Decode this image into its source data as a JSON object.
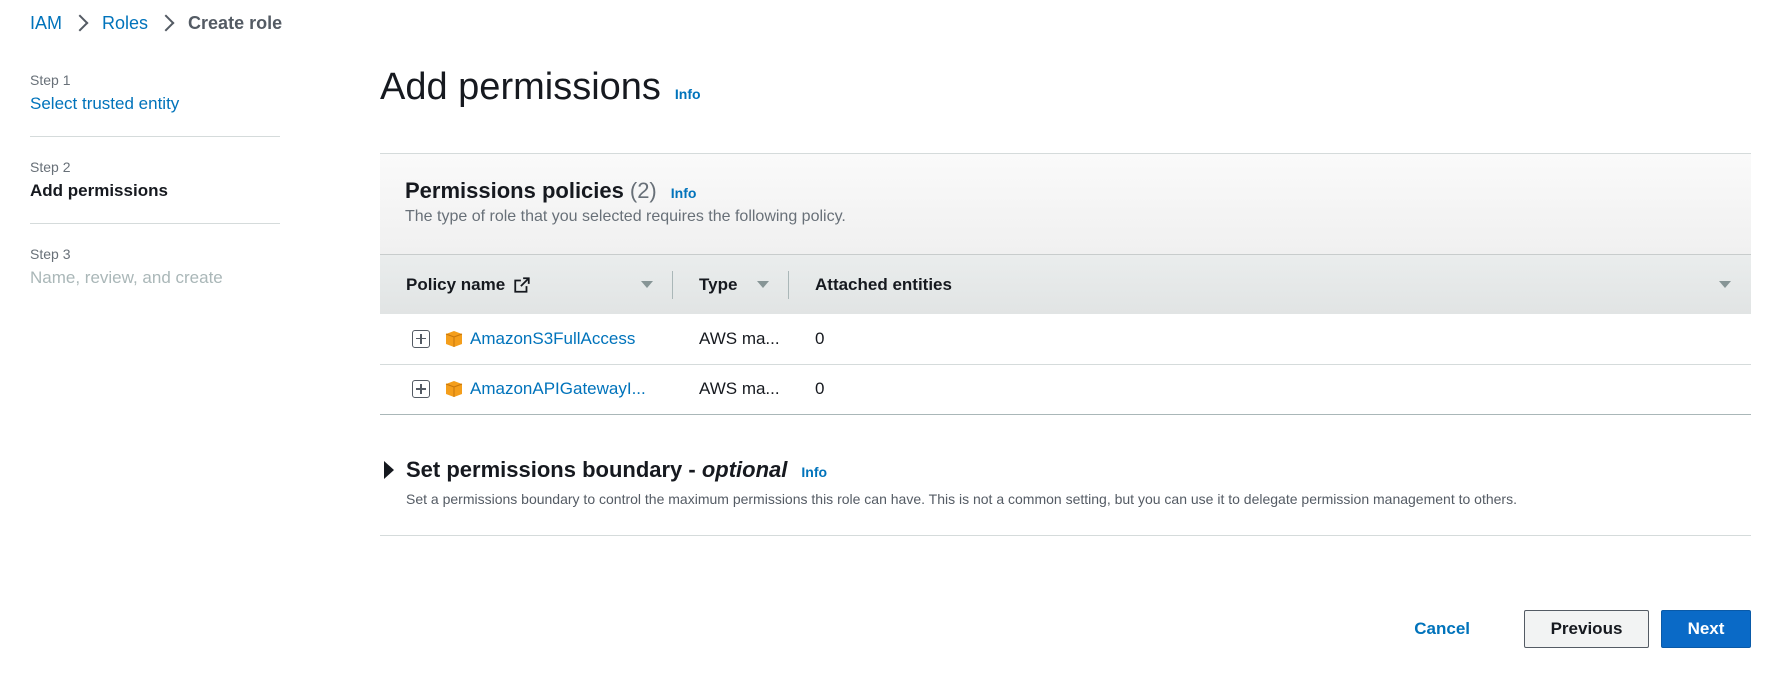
{
  "breadcrumb": {
    "items": [
      "IAM",
      "Roles"
    ],
    "current": "Create role"
  },
  "steps": [
    {
      "num": "Step 1",
      "title": "Select trusted entity",
      "state": "link"
    },
    {
      "num": "Step 2",
      "title": "Add permissions",
      "state": "active"
    },
    {
      "num": "Step 3",
      "title": "Name, review, and create",
      "state": "disabled"
    }
  ],
  "page": {
    "title": "Add permissions",
    "info": "Info"
  },
  "policies_panel": {
    "title": "Permissions policies",
    "count": "(2)",
    "info": "Info",
    "description": "The type of role that you selected requires the following policy.",
    "columns": [
      "Policy name",
      "Type",
      "Attached entities"
    ],
    "rows": [
      {
        "name": "AmazonS3FullAccess",
        "type": "AWS ma...",
        "attached": "0"
      },
      {
        "name": "AmazonAPIGatewayI...",
        "type": "AWS ma...",
        "attached": "0"
      }
    ]
  },
  "boundary": {
    "title": "Set permissions boundary - ",
    "title_optional": "optional",
    "info": "Info",
    "description": "Set a permissions boundary to control the maximum permissions this role can have. This is not a common setting, but you can use it to delegate permission management to others."
  },
  "actions": {
    "cancel": "Cancel",
    "previous": "Previous",
    "next": "Next"
  },
  "icons": {
    "breadcrumb_separator": "chevron-right-icon",
    "external_link": "external-link-icon",
    "sort": "caret-down-icon",
    "expand": "plus-square-icon",
    "aws_managed": "aws-cube-icon",
    "collapse_toggle": "caret-right-icon"
  },
  "colors": {
    "link": "#0073bb",
    "primary_button": "#0a6ac7",
    "aws_orange": "#f49e1b"
  }
}
